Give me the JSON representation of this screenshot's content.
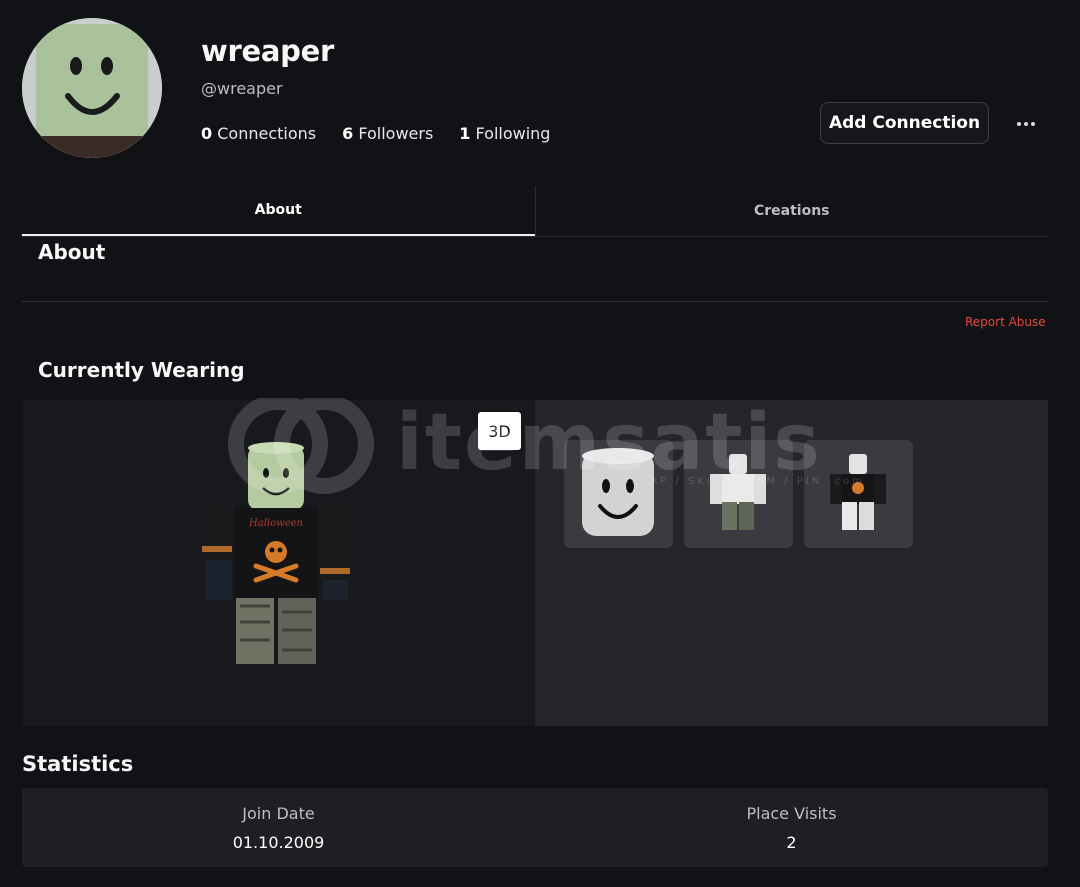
{
  "profile": {
    "display_name": "wreaper",
    "handle": "@wreaper",
    "stats": [
      {
        "count": "0",
        "label": "Connections"
      },
      {
        "count": "6",
        "label": "Followers"
      },
      {
        "count": "1",
        "label": "Following"
      }
    ],
    "add_connection_label": "Add Connection",
    "more_icon": "ellipsis-icon"
  },
  "tabs": [
    {
      "label": "About",
      "active": true
    },
    {
      "label": "Creations",
      "active": false
    }
  ],
  "about": {
    "heading": "About",
    "report_label": "Report Abuse"
  },
  "wearing": {
    "heading": "Currently Wearing",
    "toggle_label": "3D",
    "items": [
      {
        "name": "smiley-face-head"
      },
      {
        "name": "camo-pants"
      },
      {
        "name": "halloween-skull-shirt"
      }
    ]
  },
  "watermark": {
    "brand": "itemsatis",
    "tagline": "HESAP / SKIN / ITEM / PIN .com"
  },
  "statistics": {
    "heading": "Statistics",
    "items": [
      {
        "label": "Join Date",
        "value": "01.10.2009"
      },
      {
        "label": "Place Visits",
        "value": "2"
      }
    ]
  },
  "colors": {
    "background": "#111215",
    "report": "#e6493c",
    "panel_left": "#18191d",
    "panel_right": "#25262b"
  }
}
